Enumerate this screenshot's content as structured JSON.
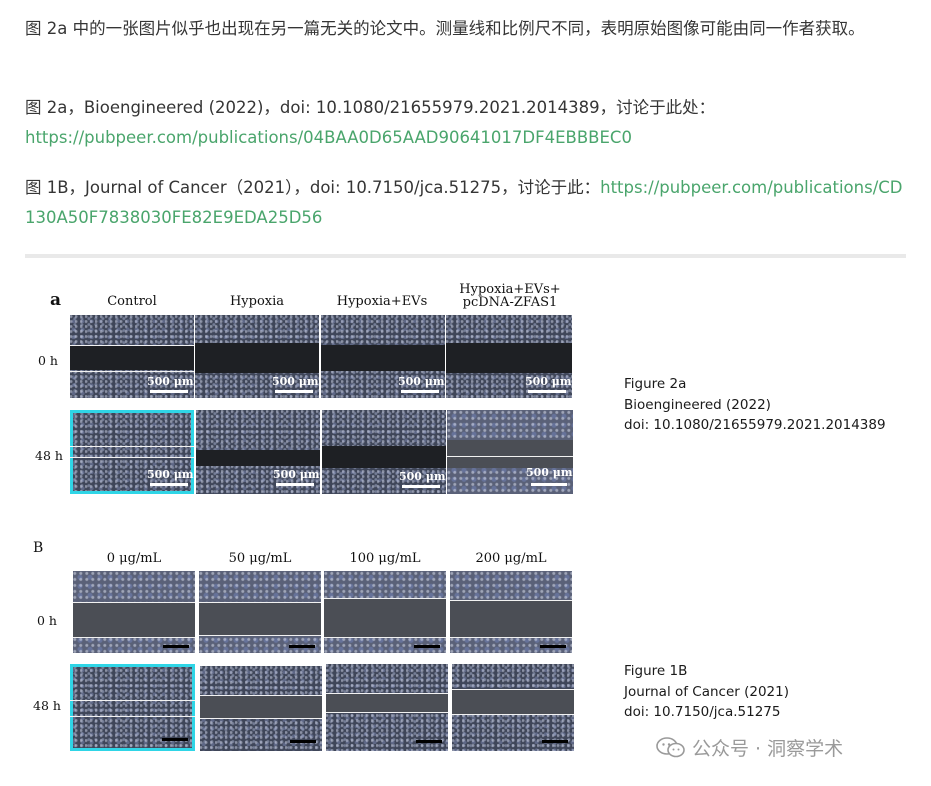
{
  "paragraphs": {
    "p1": "图 2a 中的一张图片似乎也出现在另一篇无关的论文中。测量线和比例尺不同，表明原始图像可能由同一作者获取。",
    "p2_text": "图 2a，Bioengineered (2022)，doi: 10.1080/21655979.2021.2014389，讨论于此处：",
    "p2_link": "https://pubpeer.com/publications/04BAA0D65AAD90641017DF4EBBBEC0",
    "p3_text": "图 1B，Journal of Cancer（2021），doi: 10.7150/jca.51275，讨论于此：",
    "p3_link": "https://pubpeer.com/publications/CD130A50F7838030FE82E9EDA25D56"
  },
  "figure_a": {
    "letter": "a",
    "columns": [
      "Control",
      "Hypoxia",
      "Hypoxia+EVs",
      "Hypoxia+EVs+ pcDNA-ZFAS1"
    ],
    "rows": [
      "0 h",
      "48 h"
    ],
    "scale_label": "500 μm"
  },
  "figure_b": {
    "letter": "B",
    "columns": [
      "0 μg/mL",
      "50 μg/mL",
      "100 μg/mL",
      "200 μg/mL"
    ],
    "rows": [
      "0 h",
      "48 h"
    ]
  },
  "captions": {
    "a": [
      "Figure 2a",
      "Bioengineered (2022)",
      "doi: 10.1080/21655979.2021.2014389"
    ],
    "b": [
      "Figure 1B",
      "Journal of Cancer (2021)",
      "doi: 10.7150/jca.51275"
    ]
  },
  "watermark": {
    "text": "公众号 · 洞察学术",
    "icon": "wechat-icon"
  },
  "colors": {
    "link": "#4aa56c",
    "highlight": "#2fd5e6"
  }
}
